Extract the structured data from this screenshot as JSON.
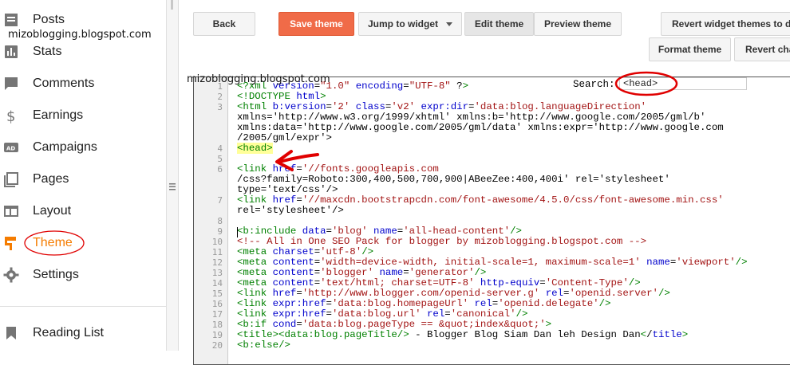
{
  "sidebar": {
    "items": [
      {
        "label": "Posts",
        "icon": "posts-icon"
      },
      {
        "label": "Stats",
        "icon": "stats-icon"
      },
      {
        "label": "Comments",
        "icon": "comments-icon"
      },
      {
        "label": "Earnings",
        "icon": "dollar-icon"
      },
      {
        "label": "Campaigns",
        "icon": "ad-icon"
      },
      {
        "label": "Pages",
        "icon": "pages-icon"
      },
      {
        "label": "Layout",
        "icon": "layout-icon"
      },
      {
        "label": "Theme",
        "icon": "paint-roller-icon",
        "active": true
      },
      {
        "label": "Settings",
        "icon": "gear-icon"
      },
      {
        "label": "Reading List",
        "icon": "bookmark-icon"
      }
    ],
    "accent": "#f57c00"
  },
  "watermarks": {
    "sidebar": "mizoblogging.blogspot.com",
    "editor": "mizoblogging.blogspot.com"
  },
  "toolbar": {
    "back": "Back",
    "save_theme": "Save theme",
    "jump_to_widget": "Jump to widget",
    "edit_theme": "Edit theme",
    "preview_theme": "Preview theme",
    "revert_widget_themes": "Revert widget themes to d",
    "format_theme": "Format theme",
    "revert_cha": "Revert cha",
    "save_color": "#f06b48"
  },
  "search": {
    "label": "Search:",
    "value": "<head>"
  },
  "editor": {
    "line_numbers": [
      "1",
      "2",
      "3",
      "",
      "",
      "",
      "4",
      "5",
      "6",
      "",
      "",
      "7",
      "",
      "8",
      "9",
      "10",
      "11",
      "12",
      "13",
      "14",
      "15",
      "16",
      "17",
      "18",
      "19",
      "20"
    ],
    "lines": [
      {
        "n": "1",
        "text": "<?xml version=\"1.0\" encoding=\"UTF-8\" ?>"
      },
      {
        "n": "2",
        "text": "<!DOCTYPE html>"
      },
      {
        "n": "3",
        "text": "<html b:version='2' class='v2' expr:dir='data:blog.languageDirection'"
      },
      {
        "n": "",
        "text": "xmlns='http://www.w3.org/1999/xhtml' xmlns:b='http://www.google.com/2005/gml/b'"
      },
      {
        "n": "",
        "text": "xmlns:data='http://www.google.com/2005/gml/data' xmlns:expr='http://www.google.com"
      },
      {
        "n": "",
        "text": "/2005/gml/expr'>"
      },
      {
        "n": "4",
        "text": "<head>"
      },
      {
        "n": "5",
        "text": ""
      },
      {
        "n": "6",
        "text": "<link href='//fonts.googleapis.com"
      },
      {
        "n": "",
        "text": "/css?family=Roboto:300,400,500,700,900|ABeeZee:400,400i' rel='stylesheet'"
      },
      {
        "n": "",
        "text": "type='text/css'/>"
      },
      {
        "n": "7",
        "text": "<link href='//maxcdn.bootstrapcdn.com/font-awesome/4.5.0/css/font-awesome.min.css'"
      },
      {
        "n": "",
        "text": "rel='stylesheet'/>"
      },
      {
        "n": "8",
        "text": ""
      },
      {
        "n": "9",
        "text": "<b:include data='blog' name='all-head-content'/>"
      },
      {
        "n": "10",
        "text": "<!-- All in One SEO Pack for blogger by mizoblogging.blogspot.com -->"
      },
      {
        "n": "11",
        "text": "<meta charset='utf-8'/>"
      },
      {
        "n": "12",
        "text": "<meta content='width=device-width, initial-scale=1, maximum-scale=1' name='viewport'/>"
      },
      {
        "n": "13",
        "text": "<meta content='blogger' name='generator'/>"
      },
      {
        "n": "14",
        "text": "<meta content='text/html; charset=UTF-8' http-equiv='Content-Type'/>"
      },
      {
        "n": "15",
        "text": "<link href='http://www.blogger.com/openid-server.g' rel='openid.server'/>"
      },
      {
        "n": "16",
        "text": "<link expr:href='data:blog.homepageUrl' rel='openid.delegate'/>"
      },
      {
        "n": "17",
        "text": "<link expr:href='data:blog.url' rel='canonical'/>"
      },
      {
        "n": "18",
        "text": "<b:if cond='data:blog.pageType == &quot;index&quot;'>"
      },
      {
        "n": "19",
        "text": "<title><data:blog.pageTitle/> - Blogger Blog Siam Dan leh Design Dan</title>"
      },
      {
        "n": "20",
        "text": "<b:else/>"
      }
    ]
  },
  "annotation_color": "#e00000"
}
